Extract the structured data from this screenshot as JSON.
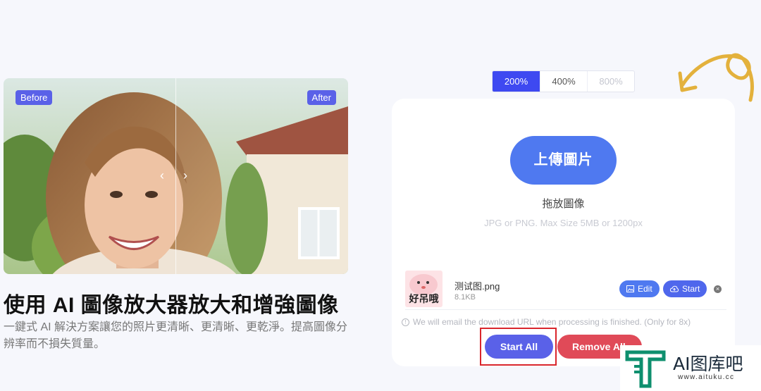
{
  "preview": {
    "before_label": "Before",
    "after_label": "After"
  },
  "headline": "使用 AI 圖像放大器放大和增強圖像",
  "description": "一鍵式 AI 解決方案讓您的照片更清晰、更清晰、更乾淨。提高圖像分辨率而不損失質量。",
  "scales": [
    {
      "label": "200%",
      "state": "active"
    },
    {
      "label": "400%",
      "state": "normal"
    },
    {
      "label": "800%",
      "state": "disabled"
    }
  ],
  "upload": {
    "button_label": "上傳圖片",
    "drop_text": "拖放圖像",
    "limits_text": "JPG or PNG. Max Size 5MB or 1200px"
  },
  "file": {
    "thumb_text": "好吊哦",
    "name": "测试图.png",
    "size": "8.1KB",
    "edit_label": "Edit",
    "start_label": "Start",
    "edit_icon": "image-edit-icon",
    "start_icon": "cloud-upload-icon"
  },
  "notice": "We will email the download URL when processing is finished. (Only for 8x)",
  "actions": {
    "start_all": "Start All",
    "remove_all": "Remove All"
  },
  "watermark": {
    "title": "AI图库吧",
    "url": "www.aituku.cc"
  },
  "colors": {
    "accent": "#3e49f1",
    "upload_blue": "#4f79f0",
    "remove_red": "#e04a58",
    "highlight_red": "#d9262c",
    "squiggle": "#e3b13c"
  }
}
